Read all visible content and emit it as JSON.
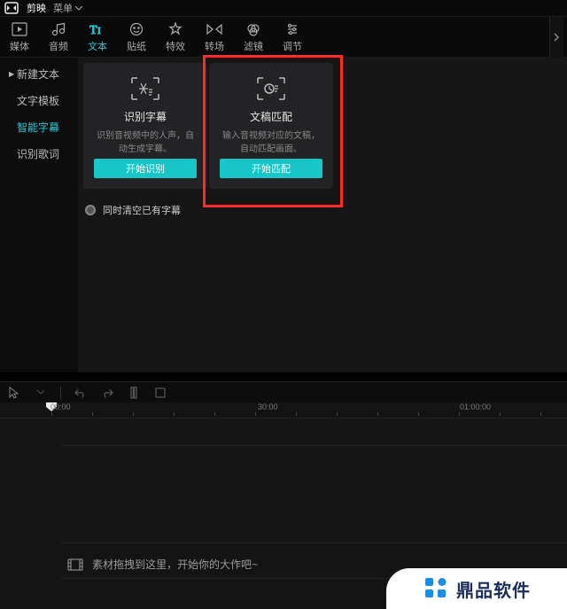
{
  "title_bar": {
    "app_name": "剪映",
    "menu_label": "菜单"
  },
  "tool_tabs": [
    {
      "id": "media",
      "label": "媒体"
    },
    {
      "id": "audio",
      "label": "音频"
    },
    {
      "id": "text",
      "label": "文本"
    },
    {
      "id": "sticker",
      "label": "贴纸"
    },
    {
      "id": "effect",
      "label": "特效"
    },
    {
      "id": "transition",
      "label": "转场"
    },
    {
      "id": "filter",
      "label": "滤镜"
    },
    {
      "id": "adjust",
      "label": "调节"
    }
  ],
  "sidebar": {
    "items": [
      {
        "id": "new-text",
        "label": "新建文本",
        "caret": true
      },
      {
        "id": "text-template",
        "label": "文字模板"
      },
      {
        "id": "smart-subtitle",
        "label": "智能字幕",
        "active": true
      },
      {
        "id": "recog-lyrics",
        "label": "识别歌词"
      }
    ]
  },
  "cards": [
    {
      "id": "recognize",
      "title": "识别字幕",
      "desc": "识别音视频中的人声，自动生成字幕。",
      "button": "开始识别"
    },
    {
      "id": "match",
      "title": "文稿匹配",
      "desc": "输入音视频对应的文稿，自动匹配画面。",
      "button": "开始匹配"
    }
  ],
  "clear_checkbox": "同时清空已有字幕",
  "ruler_labels": [
    "00:00",
    "30:00",
    "01:00:00"
  ],
  "drop_hint": "素材拖拽到这里，开始你的大作吧~",
  "watermark_text": "鼎品软件",
  "colors": {
    "accent": "#17c6c6",
    "highlight": "#ff2a2a"
  }
}
